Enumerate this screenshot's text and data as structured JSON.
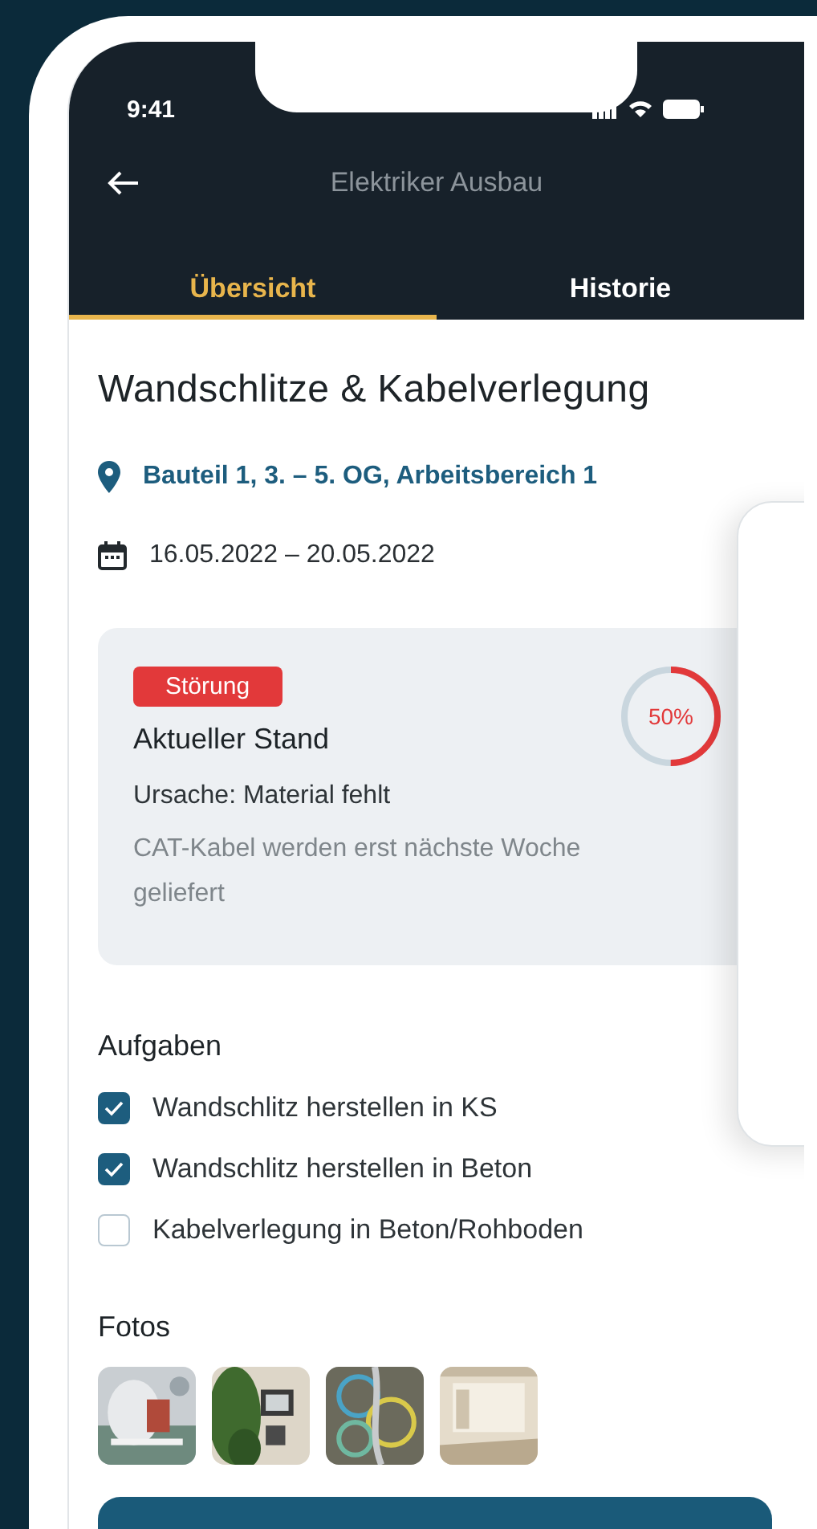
{
  "status_bar": {
    "time": "9:41"
  },
  "header": {
    "title": "Elektriker Ausbau"
  },
  "tabs": [
    {
      "label": "Übersicht",
      "selected": true
    },
    {
      "label": "Historie",
      "selected": false
    }
  ],
  "task": {
    "title": "Wandschlitze & Kabelverlegung",
    "location": "Bauteil 1, 3. – 5. OG, Arbeitsbereich 1",
    "dates": "16.05.2022 – 20.05.2022"
  },
  "status_card": {
    "badge": "Störung",
    "heading": "Aktueller Stand",
    "cause": "Ursache: Material fehlt",
    "note": "CAT-Kabel werden erst nächste Woche geliefert",
    "progress": {
      "level": 0.5,
      "reading": "50%"
    }
  },
  "tasks_label": "Aufgaben",
  "tasks": [
    {
      "label": "Wandschlitz herstellen in KS",
      "checked": true
    },
    {
      "label": "Wandschlitz herstellen in Beton",
      "checked": true
    },
    {
      "label": "Kabelverlegung in Beton/Rohboden",
      "checked": false
    }
  ],
  "photos_label": "Fotos"
}
